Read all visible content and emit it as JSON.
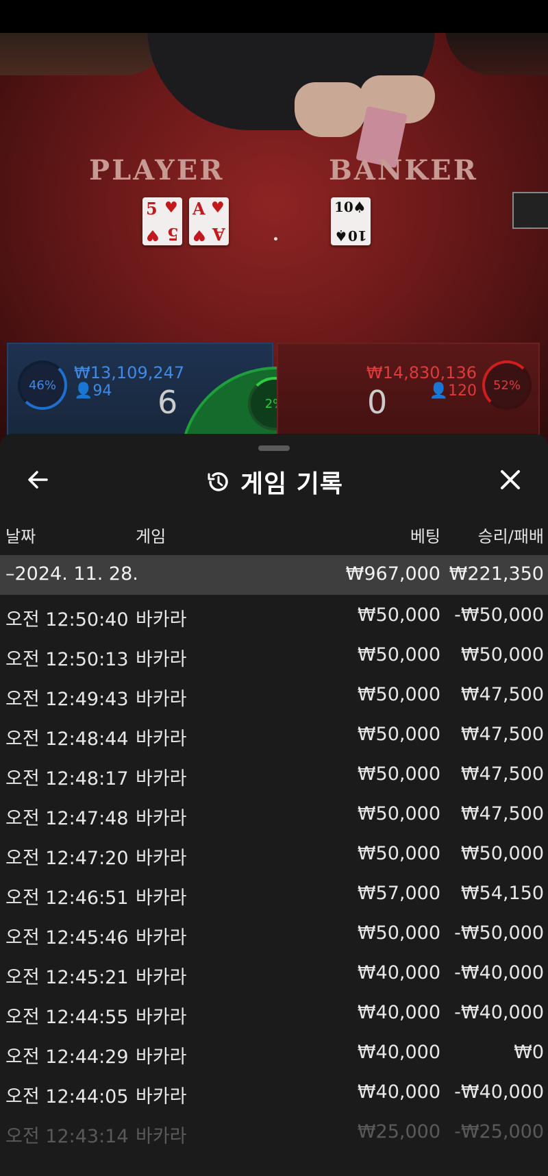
{
  "table": {
    "player_label": "PLAYER",
    "banker_label": "BANKER",
    "player_cards": [
      {
        "rank": "5",
        "suit": "♥",
        "color": "#c2191f"
      },
      {
        "rank": "A",
        "suit": "♥",
        "color": "#c2191f"
      }
    ],
    "banker_cards": [
      {
        "rank": "10",
        "suit": "♠",
        "color": "#111111"
      }
    ]
  },
  "bet_panels": {
    "player": {
      "percent": "46%",
      "amount": "₩13,109,247",
      "bettors": "94",
      "score": "6",
      "color": "#3e8ae6"
    },
    "tie": {
      "percent": "2%",
      "color": "#2ecc40"
    },
    "banker": {
      "percent": "52%",
      "amount": "₩14,830,136",
      "bettors": "120",
      "score": "0",
      "color": "#e03a3a"
    }
  },
  "history": {
    "title": "게임 기록",
    "columns": {
      "date": "날짜",
      "game": "게임",
      "bet": "베팅",
      "result": "승리/패배"
    },
    "date_group": {
      "date": "–2024. 11. 28.",
      "total_bet": "₩967,000",
      "total_result": "₩221,350"
    },
    "rows": [
      {
        "time": "오전 12:50:40",
        "game": "바카라",
        "bet": "₩50,000",
        "result": "-₩50,000"
      },
      {
        "time": "오전 12:50:13",
        "game": "바카라",
        "bet": "₩50,000",
        "result": "₩50,000"
      },
      {
        "time": "오전 12:49:43",
        "game": "바카라",
        "bet": "₩50,000",
        "result": "₩47,500"
      },
      {
        "time": "오전 12:48:44",
        "game": "바카라",
        "bet": "₩50,000",
        "result": "₩47,500"
      },
      {
        "time": "오전 12:48:17",
        "game": "바카라",
        "bet": "₩50,000",
        "result": "₩47,500"
      },
      {
        "time": "오전 12:47:48",
        "game": "바카라",
        "bet": "₩50,000",
        "result": "₩47,500"
      },
      {
        "time": "오전 12:47:20",
        "game": "바카라",
        "bet": "₩50,000",
        "result": "₩50,000"
      },
      {
        "time": "오전 12:46:51",
        "game": "바카라",
        "bet": "₩57,000",
        "result": "₩54,150"
      },
      {
        "time": "오전 12:45:46",
        "game": "바카라",
        "bet": "₩50,000",
        "result": "-₩50,000"
      },
      {
        "time": "오전 12:45:21",
        "game": "바카라",
        "bet": "₩40,000",
        "result": "-₩40,000"
      },
      {
        "time": "오전 12:44:55",
        "game": "바카라",
        "bet": "₩40,000",
        "result": "-₩40,000"
      },
      {
        "time": "오전 12:44:29",
        "game": "바카라",
        "bet": "₩40,000",
        "result": "₩0"
      },
      {
        "time": "오전 12:44:05",
        "game": "바카라",
        "bet": "₩40,000",
        "result": "-₩40,000"
      },
      {
        "time": "오전 12:43:14",
        "game": "바카라",
        "bet": "₩25,000",
        "result": "-₩25,000"
      }
    ]
  }
}
